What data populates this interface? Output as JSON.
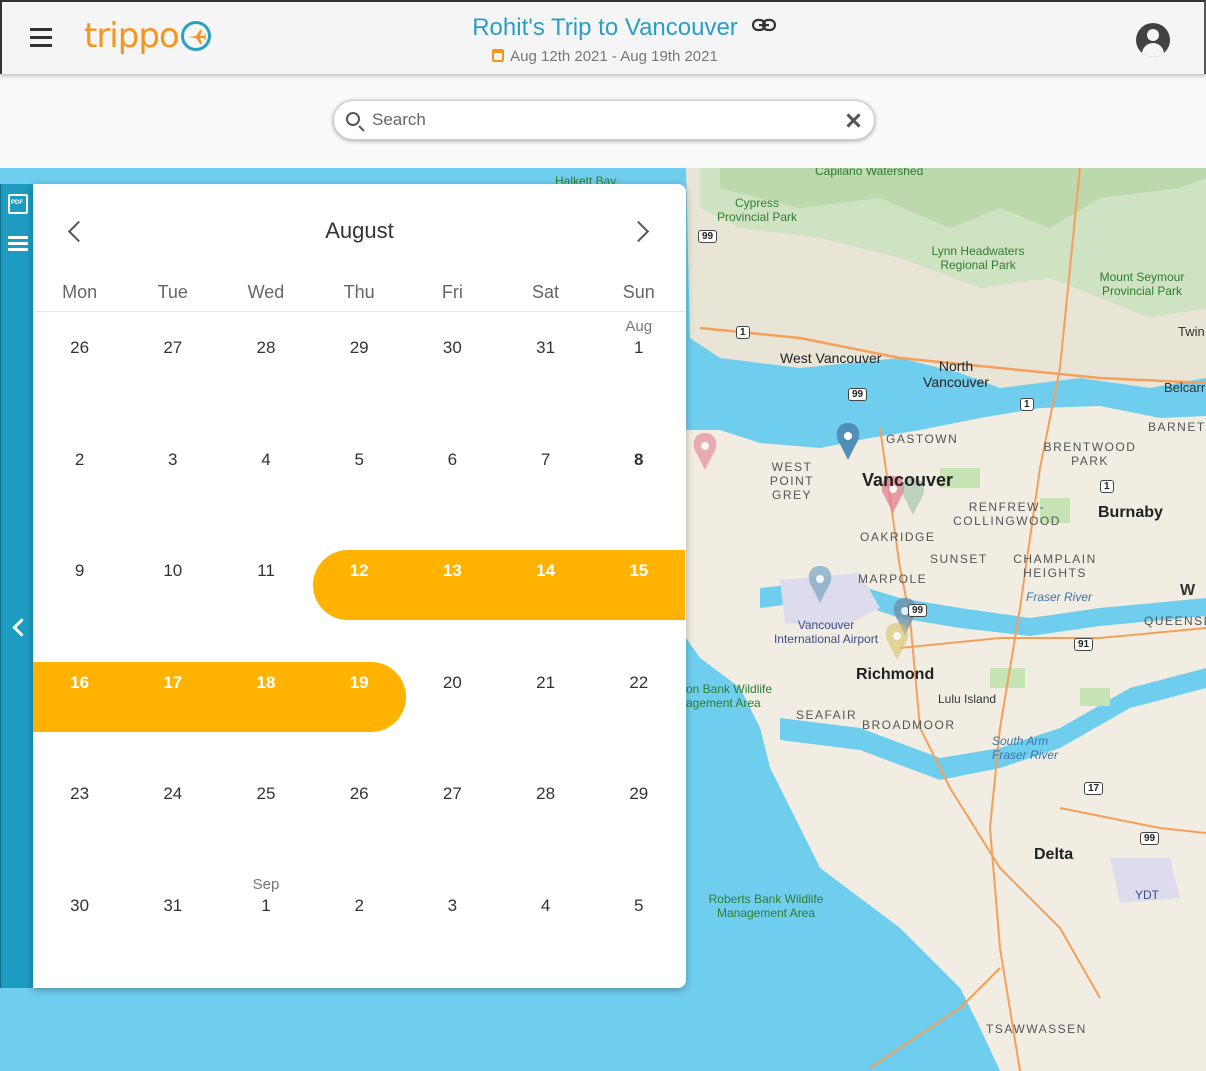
{
  "header": {
    "logo": "trippo",
    "trip_title": "Rohit's Trip to Vancouver",
    "dates": "Aug 12th 2021 - Aug 19th 2021"
  },
  "search": {
    "placeholder": "Search"
  },
  "calendar": {
    "month": "August",
    "weekdays": [
      "Mon",
      "Tue",
      "Wed",
      "Thu",
      "Fri",
      "Sat",
      "Sun"
    ],
    "weeks": [
      [
        {
          "d": "26"
        },
        {
          "d": "27"
        },
        {
          "d": "28"
        },
        {
          "d": "29"
        },
        {
          "d": "30"
        },
        {
          "d": "31"
        },
        {
          "d": "1",
          "m": "Aug"
        }
      ],
      [
        {
          "d": "2"
        },
        {
          "d": "3"
        },
        {
          "d": "4"
        },
        {
          "d": "5"
        },
        {
          "d": "6"
        },
        {
          "d": "7"
        },
        {
          "d": "8",
          "bold": true
        }
      ],
      [
        {
          "d": "9"
        },
        {
          "d": "10"
        },
        {
          "d": "11"
        },
        {
          "d": "12",
          "sel": true
        },
        {
          "d": "13",
          "sel": true
        },
        {
          "d": "14",
          "sel": true
        },
        {
          "d": "15",
          "sel": true
        }
      ],
      [
        {
          "d": "16",
          "sel": true
        },
        {
          "d": "17",
          "sel": true
        },
        {
          "d": "18",
          "sel": true
        },
        {
          "d": "19",
          "sel": true
        },
        {
          "d": "20"
        },
        {
          "d": "21"
        },
        {
          "d": "22"
        }
      ],
      [
        {
          "d": "23"
        },
        {
          "d": "24"
        },
        {
          "d": "25"
        },
        {
          "d": "26"
        },
        {
          "d": "27"
        },
        {
          "d": "28"
        },
        {
          "d": "29"
        }
      ],
      [
        {
          "d": "30"
        },
        {
          "d": "31"
        },
        {
          "d": "1",
          "m": "Sep"
        },
        {
          "d": "2"
        },
        {
          "d": "3"
        },
        {
          "d": "4"
        },
        {
          "d": "5"
        }
      ]
    ],
    "range_color": "#ffb300"
  },
  "map": {
    "labels": {
      "vancouver": "Vancouver",
      "burnaby": "Burnaby",
      "richmond": "Richmond",
      "delta": "Delta",
      "west_vancouver": "West Vancouver",
      "north_vancouver": "North Vancouver",
      "gastown": "GASTOWN",
      "west_point_grey": "WEST POINT GREY",
      "oakridge": "OAKRIDGE",
      "sunset": "SUNSET",
      "marpole": "MARPOLE",
      "renfrew": "RENFREW-COLLINGWOOD",
      "champlain": "CHAMPLAIN HEIGHTS",
      "brentwood": "BRENTWOOD PARK",
      "barnet": "BARNET",
      "seafair": "SEAFAIR",
      "broadmoor": "BROADMOOR",
      "lulu": "Lulu Island",
      "tsawwassen": "TSAWWASSEN",
      "queensb": "QUEENSB",
      "airport": "Vancouver International Airport",
      "ydt": "YDT",
      "fraser": "Fraser River",
      "south_arm": "South Arm Fraser River",
      "cypress": "Cypress Provincial Park",
      "lynn": "Lynn Headwaters Regional Park",
      "seymour": "Mount Seymour Provincial Park",
      "roberts1": "Roberts Bank Wildlife Management Area",
      "roberts2": "on Bank Wildlife agement Area",
      "capilano": "Capilano Watershed",
      "halkett": "Halkett Bay",
      "twin": "Twin",
      "belcarra": "Belcarr",
      "w": "W"
    },
    "shields": [
      "99",
      "1",
      "99",
      "1",
      "1",
      "99",
      "91",
      "17",
      "99"
    ]
  }
}
